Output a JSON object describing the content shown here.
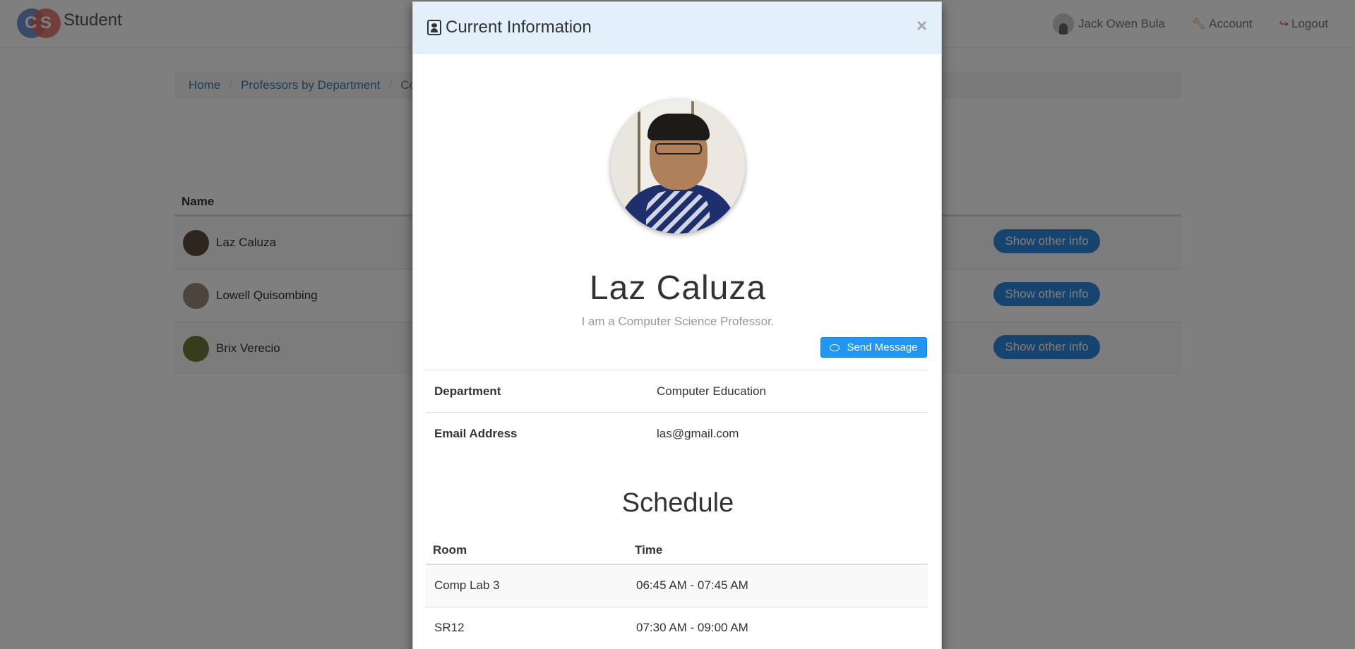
{
  "navbar": {
    "brand_letters": [
      "C",
      "S"
    ],
    "brand_text": "Student",
    "user_name": "Jack Owen Bula",
    "account_label": "Account",
    "logout_label": "Logout"
  },
  "breadcrumb": {
    "items": [
      "Home",
      "Professors by Department",
      "Com"
    ]
  },
  "professors": {
    "header": "Name",
    "rows": [
      {
        "name": "Laz Caluza",
        "button": "Show other info"
      },
      {
        "name": "Lowell Quisombing",
        "button": "Show other info"
      },
      {
        "name": "Brix Verecio",
        "button": "Show other info"
      }
    ]
  },
  "modal": {
    "title": "Current Information",
    "close": "×",
    "name": "Laz Caluza",
    "description": "I am a Computer Science Professor.",
    "send_message": "Send Message",
    "info": [
      {
        "label": "Department",
        "value": "Computer Education"
      },
      {
        "label": "Email Address",
        "value": "las@gmail.com"
      }
    ],
    "schedule_title": "Schedule",
    "schedule_headers": [
      "Room",
      "Time"
    ],
    "schedule": [
      {
        "room": "Comp Lab 3",
        "time": "06:45 AM - 07:45 AM"
      },
      {
        "room": "SR12",
        "time": "07:30 AM - 09:00 AM"
      }
    ]
  },
  "colors": {
    "primary_button": "#2e86de",
    "modal_header_bg": "#e3f0fb",
    "link": "#337ab7"
  }
}
